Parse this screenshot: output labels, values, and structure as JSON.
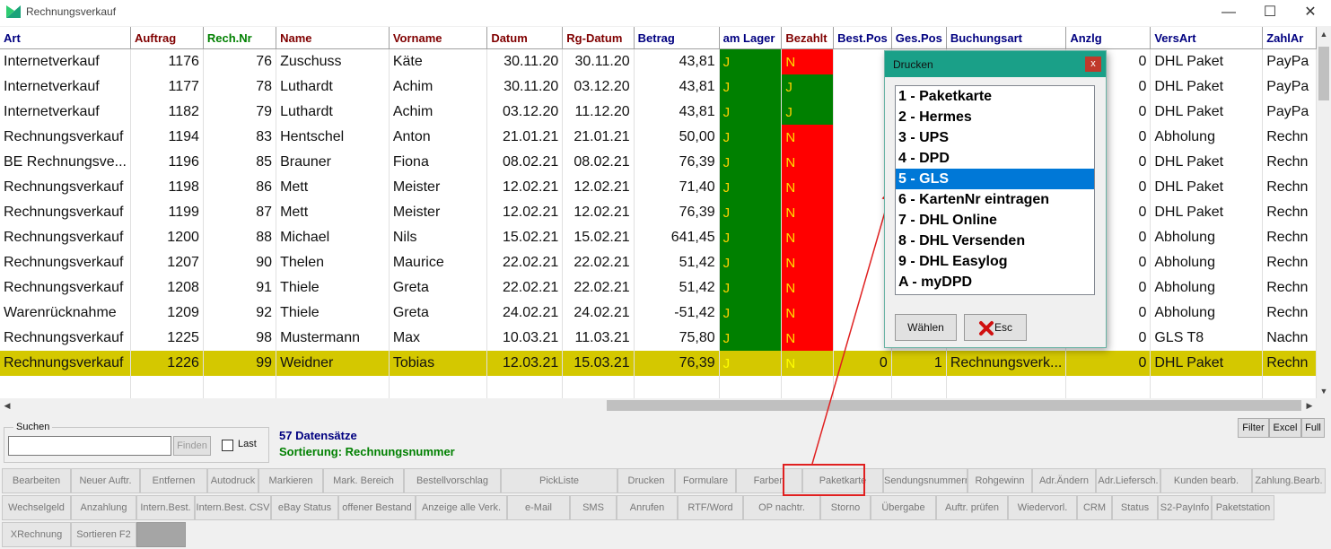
{
  "window": {
    "title": "Rechnungsverkauf"
  },
  "grid": {
    "columns": [
      {
        "label": "Art",
        "color": "#000080"
      },
      {
        "label": "Auftrag",
        "color": "#800000"
      },
      {
        "label": "Rech.Nr",
        "color": "#008000"
      },
      {
        "label": "Name",
        "color": "#800000"
      },
      {
        "label": "Vorname",
        "color": "#800000"
      },
      {
        "label": "Datum",
        "color": "#800000"
      },
      {
        "label": "Rg-Datum",
        "color": "#800000"
      },
      {
        "label": "Betrag",
        "color": "#000080"
      },
      {
        "label": "am Lager",
        "color": "#000080"
      },
      {
        "label": "Bezahlt",
        "color": "#800000"
      },
      {
        "label": "Best.Pos",
        "color": "#000080"
      },
      {
        "label": "Ges.Pos",
        "color": "#000080"
      },
      {
        "label": "Buchungsart",
        "color": "#000080"
      },
      {
        "label": "Anzlg",
        "color": "#000080"
      },
      {
        "label": "VersArt",
        "color": "#000080"
      },
      {
        "label": "ZahlAr",
        "color": "#000080"
      }
    ],
    "rows": [
      [
        "Internetverkauf",
        "1176",
        "76",
        "Zuschuss",
        "Käte",
        "30.11.20",
        "30.11.20",
        "43,81",
        "J",
        "N",
        "",
        "",
        "",
        "0",
        "DHL Paket",
        "PayPa"
      ],
      [
        "Internetverkauf",
        "1177",
        "78",
        "Luthardt",
        "Achim",
        "30.11.20",
        "03.12.20",
        "43,81",
        "J",
        "J",
        "",
        "",
        "",
        "0",
        "DHL Paket",
        "PayPa"
      ],
      [
        "Internetverkauf",
        "1182",
        "79",
        "Luthardt",
        "Achim",
        "03.12.20",
        "11.12.20",
        "43,81",
        "J",
        "J",
        "",
        "",
        "",
        "0",
        "DHL Paket",
        "PayPa"
      ],
      [
        "Rechnungsverkauf",
        "1194",
        "83",
        "Hentschel",
        "Anton",
        "21.01.21",
        "21.01.21",
        "50,00",
        "J",
        "N",
        "",
        "",
        "",
        "0",
        "Abholung",
        "Rechn"
      ],
      [
        "BE Rechnungsve...",
        "1196",
        "85",
        "Brauner",
        "Fiona",
        "08.02.21",
        "08.02.21",
        "76,39",
        "J",
        "N",
        "",
        "",
        "",
        "0",
        "DHL Paket",
        "Rechn"
      ],
      [
        "Rechnungsverkauf",
        "1198",
        "86",
        "Mett",
        "Meister",
        "12.02.21",
        "12.02.21",
        "71,40",
        "J",
        "N",
        "",
        "",
        "",
        "0",
        "DHL Paket",
        "Rechn"
      ],
      [
        "Rechnungsverkauf",
        "1199",
        "87",
        "Mett",
        "Meister",
        "12.02.21",
        "12.02.21",
        "76,39",
        "J",
        "N",
        "",
        "",
        "",
        "0",
        "DHL Paket",
        "Rechn"
      ],
      [
        "Rechnungsverkauf",
        "1200",
        "88",
        "Michael",
        "Nils",
        "15.02.21",
        "15.02.21",
        "641,45",
        "J",
        "N",
        "",
        "",
        "",
        "0",
        "Abholung",
        "Rechn"
      ],
      [
        "Rechnungsverkauf",
        "1207",
        "90",
        "Thelen",
        "Maurice",
        "22.02.21",
        "22.02.21",
        "51,42",
        "J",
        "N",
        "",
        "",
        "",
        "0",
        "Abholung",
        "Rechn"
      ],
      [
        "Rechnungsverkauf",
        "1208",
        "91",
        "Thiele",
        "Greta",
        "22.02.21",
        "22.02.21",
        "51,42",
        "J",
        "N",
        "",
        "",
        "",
        "0",
        "Abholung",
        "Rechn"
      ],
      [
        "Warenrücknahme",
        "1209",
        "92",
        "Thiele",
        "Greta",
        "24.02.21",
        "24.02.21",
        "-51,42",
        "J",
        "N",
        "",
        "",
        "",
        "0",
        "Abholung",
        "Rechn"
      ],
      [
        "Rechnungsverkauf",
        "1225",
        "98",
        "Mustermann",
        "Max",
        "10.03.21",
        "11.03.21",
        "75,80",
        "J",
        "N",
        "",
        "",
        "",
        "0",
        "GLS T8",
        "Nachn"
      ],
      [
        "Rechnungsverkauf",
        "1226",
        "99",
        "Weidner",
        "Tobias",
        "12.03.21",
        "15.03.21",
        "76,39",
        "J",
        "N",
        "0",
        "1",
        "Rechnungsverk...",
        "0",
        "DHL Paket",
        "Rechn"
      ]
    ],
    "selected_row": 12
  },
  "search": {
    "legend": "Suchen",
    "value": "",
    "finden_label": "Finden",
    "last_label": "Last"
  },
  "info": {
    "count": "57 Datensätze",
    "sort": "Sortierung: Rechnungsnummer"
  },
  "top_buttons": [
    "Filter",
    "Excel",
    "Full"
  ],
  "toolbar": {
    "row1": [
      "Bearbeiten",
      "Neuer Auftr.",
      "Entfernen",
      "Autodruck",
      "Markieren",
      "Mark. Bereich",
      "Bestellvorschlag",
      "PickListe",
      "Drucken",
      "Formulare",
      "Farben",
      "Paketkarte",
      "Sendungsnummern",
      "Rohgewinn",
      "Adr.Ändern",
      "Adr.Liefersch.",
      "Kunden bearb.",
      "Zahlung.Bearb."
    ],
    "row2": [
      "Wechselgeld",
      "Anzahlung",
      "Intern.Best.",
      "Intern.Best. CSV",
      "eBay Status",
      "offener Bestand",
      "Anzeige alle Verk.",
      "e-Mail",
      "SMS",
      "Anrufen",
      "RTF/Word",
      "OP nachtr.",
      "Storno",
      "Übergabe",
      "Auftr. prüfen",
      "Wiedervorl.",
      "CRM",
      "Status",
      "S2-PayInfo",
      "Paketstation"
    ],
    "row3": [
      "XRechnung",
      "Sortieren F2",
      ""
    ]
  },
  "dialog": {
    "title": "Drucken",
    "close_label": "x",
    "items": [
      "1 -  Paketkarte",
      "2 -  Hermes",
      "3 -  UPS",
      "4 -  DPD",
      "5 -  GLS",
      "6 -  KartenNr eintragen",
      "7 -  DHL Online",
      "8 -  DHL Versenden",
      "9 -  DHL Easylog",
      "A -  myDPD"
    ],
    "selected_index": 4,
    "ok_label": "Wählen",
    "cancel_label": "Esc"
  },
  "colors": {
    "accent": "#0078d7",
    "dialog_title": "#1aa088",
    "lager_green": "#008000",
    "paid_red": "#ff0000",
    "selected_row": "#d4c800",
    "annotation_red": "#e02020"
  }
}
